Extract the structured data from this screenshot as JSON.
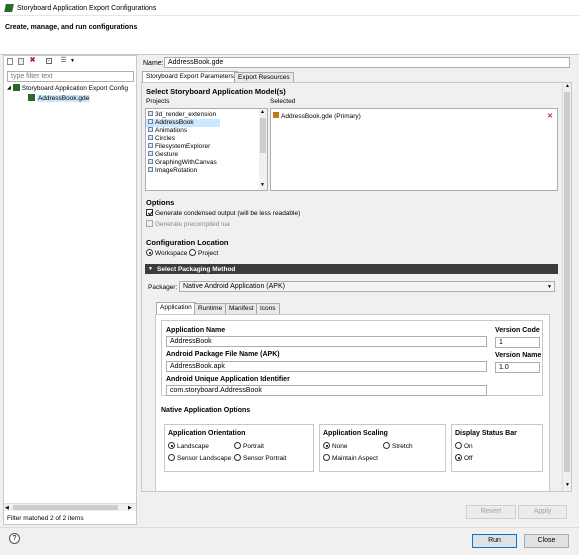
{
  "window": {
    "title": "Storyboard Application Export Configurations"
  },
  "banner": {
    "title": "Create, manage, and run configurations"
  },
  "left": {
    "filter_placeholder": "type filter text",
    "tree": {
      "root_label": "Storyboard Application Export Config",
      "child_label": "AddressBook.gde"
    },
    "status": "Filter matched 2 of 2 items"
  },
  "name_label": "Name:",
  "name_value": "AddressBook.gde",
  "config_tabs": [
    "Storyboard Export Parameters",
    "Export Resources"
  ],
  "models": {
    "heading": "Select Storyboard Application Model(s)",
    "projects_label": "Projects",
    "selected_label": "Selected",
    "projects": [
      "3d_render_extension",
      "AddressBook",
      "Animations",
      "Circles",
      "FilesystemExplorer",
      "Gesture",
      "GraphingWithCanvas",
      "ImageRotation"
    ],
    "selected_items": [
      "AddressBook.gde (Primary)"
    ],
    "remove_icon": "close-icon"
  },
  "options": {
    "heading": "Options",
    "condensed": {
      "label": "Generate condensed output (will be less readable)",
      "checked": true
    },
    "precompiled": {
      "label": "Generate precompiled lua",
      "checked": false,
      "disabled": true
    }
  },
  "config_location": {
    "heading": "Configuration Location",
    "workspace": "Workspace",
    "project": "Project",
    "selected": "Workspace"
  },
  "packaging": {
    "section_title": "Select Packaging Method",
    "packager_label": "Packager:",
    "packager_value": "Native Android Application (APK)",
    "sub_tabs": [
      "Application",
      "Runtime",
      "Manifest",
      "Icons"
    ]
  },
  "app": {
    "app_name_label": "Application Name",
    "app_name_value": "AddressBook",
    "version_code_label": "Version Code",
    "version_code_value": "1",
    "version_name_label": "Version Name",
    "version_name_value": "1.0",
    "apk_label": "Android Package File Name (APK)",
    "apk_value": "AddressBook.apk",
    "identifier_label": "Android Unique Application Identifier",
    "identifier_value": "com.storyboard.AddressBook",
    "native_heading": "Native Application Options",
    "orientation": {
      "heading": "Application Orientation",
      "landscape": "Landscape",
      "portrait": "Portrait",
      "sensor_landscape": "Sensor Landscape",
      "sensor_portrait": "Sensor Portrait",
      "selected": "Landscape"
    },
    "scaling": {
      "heading": "Application Scaling",
      "none": "None",
      "stretch": "Stretch",
      "maintain": "Maintain Aspect",
      "selected": "None"
    },
    "status_bar": {
      "heading": "Display Status Bar",
      "on": "On",
      "off": "Off",
      "selected": "Off"
    }
  },
  "buttons": {
    "revert": "Revert",
    "apply": "Apply",
    "run": "Run",
    "close": "Close",
    "help_icon": "help-icon"
  },
  "colors": {
    "accent": "#cce8ff",
    "section_bar": "#3c3c3c",
    "remove": "#c0262d"
  }
}
